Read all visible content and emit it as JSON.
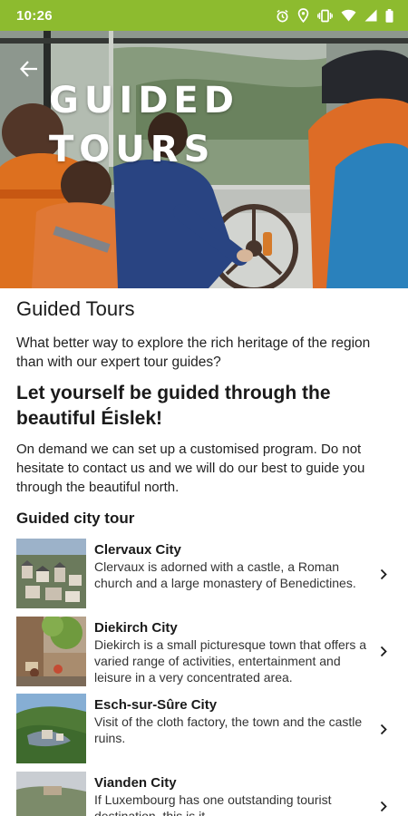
{
  "status_bar": {
    "time": "10:26",
    "icons": [
      "alarm-icon",
      "location-icon",
      "vibrate-icon",
      "wifi-icon",
      "signal-icon",
      "battery-icon"
    ]
  },
  "hero": {
    "title": "GUIDED TOURS",
    "back_icon": "arrow-back-icon"
  },
  "content": {
    "page_title": "Guided Tours",
    "intro": "What better way to explore the rich heritage of the region than with our expert tour guides?",
    "subheading": "Let yourself be guided through the beautiful Éislek!",
    "body": "On demand we can set up a customised program. Do not hesitate to contact us and we will do our best to guide you through the beautiful north.",
    "section_heading": "Guided city tour"
  },
  "tours": [
    {
      "name": "Clervaux City",
      "description": "Clervaux is adorned with a castle, a Roman church and a large monastery of Benedictines."
    },
    {
      "name": "Diekirch City",
      "description": "Diekirch is a small picturesque town that offers a varied range of activities, entertainment and leisure in a very concentrated area."
    },
    {
      "name": "Esch-sur-Sûre City",
      "description": "Visit of the cloth factory, the town and the castle ruins."
    },
    {
      "name": "Vianden City",
      "description": "If Luxembourg has one outstanding tourist destination, this is it."
    }
  ],
  "colors": {
    "status_bar": "#8dbb2f",
    "text": "#1a1a1a"
  }
}
